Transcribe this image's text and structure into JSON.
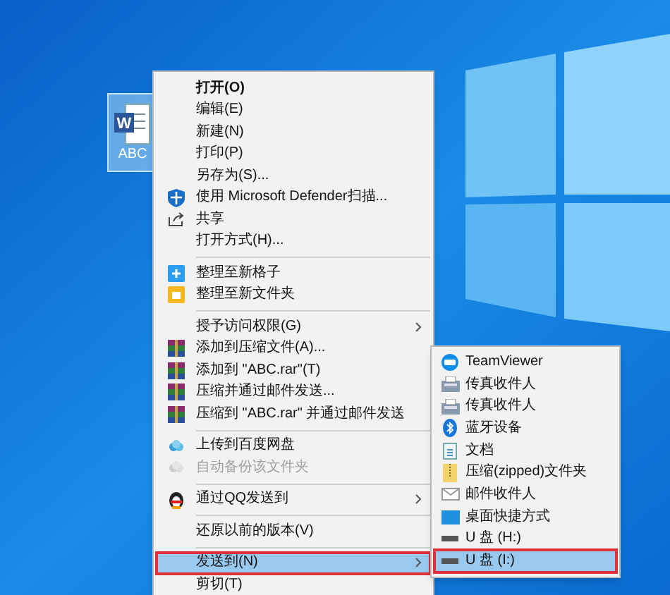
{
  "desktop_icon": {
    "app_letter": "W",
    "label": "ABC"
  },
  "context_menu": {
    "items": [
      {
        "kind": "item",
        "label": "打开(O)",
        "default": true,
        "disabled": false,
        "selected": false,
        "has_submenu": false
      },
      {
        "kind": "item",
        "label": "编辑(E)",
        "default": false,
        "disabled": false,
        "selected": false,
        "has_submenu": false
      },
      {
        "kind": "item",
        "label": "新建(N)",
        "default": false,
        "disabled": false,
        "selected": false,
        "has_submenu": false
      },
      {
        "kind": "item",
        "label": "打印(P)",
        "default": false,
        "disabled": false,
        "selected": false,
        "has_submenu": false
      },
      {
        "kind": "item",
        "label": "另存为(S)...",
        "default": false,
        "disabled": false,
        "selected": false,
        "has_submenu": false
      },
      {
        "kind": "item",
        "label": "使用 Microsoft Defender扫描...",
        "default": false,
        "disabled": false,
        "selected": false,
        "has_submenu": false
      },
      {
        "kind": "item",
        "label": "共享",
        "default": false,
        "disabled": false,
        "selected": false,
        "has_submenu": false
      },
      {
        "kind": "item",
        "label": "打开方式(H)...",
        "default": false,
        "disabled": false,
        "selected": false,
        "has_submenu": false
      },
      {
        "kind": "separator"
      },
      {
        "kind": "item",
        "label": "整理至新格子",
        "default": false,
        "disabled": false,
        "selected": false,
        "has_submenu": false
      },
      {
        "kind": "item",
        "label": "整理至新文件夹",
        "default": false,
        "disabled": false,
        "selected": false,
        "has_submenu": false
      },
      {
        "kind": "separator"
      },
      {
        "kind": "item",
        "label": "授予访问权限(G)",
        "default": false,
        "disabled": false,
        "selected": false,
        "has_submenu": true
      },
      {
        "kind": "item",
        "label": "添加到压缩文件(A)...",
        "default": false,
        "disabled": false,
        "selected": false,
        "has_submenu": false
      },
      {
        "kind": "item",
        "label": "添加到 \"ABC.rar\"(T)",
        "default": false,
        "disabled": false,
        "selected": false,
        "has_submenu": false
      },
      {
        "kind": "item",
        "label": "压缩并通过邮件发送...",
        "default": false,
        "disabled": false,
        "selected": false,
        "has_submenu": false
      },
      {
        "kind": "item",
        "label": "压缩到 \"ABC.rar\" 并通过邮件发送",
        "default": false,
        "disabled": false,
        "selected": false,
        "has_submenu": false
      },
      {
        "kind": "separator"
      },
      {
        "kind": "item",
        "label": "上传到百度网盘",
        "default": false,
        "disabled": false,
        "selected": false,
        "has_submenu": false
      },
      {
        "kind": "item",
        "label": "自动备份该文件夹",
        "default": false,
        "disabled": true,
        "selected": false,
        "has_submenu": false
      },
      {
        "kind": "separator"
      },
      {
        "kind": "item",
        "label": "通过QQ发送到",
        "default": false,
        "disabled": false,
        "selected": false,
        "has_submenu": true
      },
      {
        "kind": "separator"
      },
      {
        "kind": "item",
        "label": "还原以前的版本(V)",
        "default": false,
        "disabled": false,
        "selected": false,
        "has_submenu": false
      },
      {
        "kind": "separator"
      },
      {
        "kind": "item",
        "label": "发送到(N)",
        "default": false,
        "disabled": false,
        "selected": true,
        "has_submenu": true
      },
      {
        "kind": "item",
        "label": "剪切(T)",
        "default": false,
        "disabled": false,
        "selected": false,
        "has_submenu": false
      }
    ]
  },
  "send_to_menu": {
    "items": [
      {
        "label": "TeamViewer",
        "selected": false
      },
      {
        "label": "传真收件人",
        "selected": false
      },
      {
        "label": "传真收件人",
        "selected": false
      },
      {
        "label": "蓝牙设备",
        "selected": false
      },
      {
        "label": "文档",
        "selected": false
      },
      {
        "label": "压缩(zipped)文件夹",
        "selected": false
      },
      {
        "label": "邮件收件人",
        "selected": false
      },
      {
        "label": "桌面快捷方式",
        "selected": false
      },
      {
        "label": "U 盘 (H:)",
        "selected": false
      },
      {
        "label": "U 盘 (I:)",
        "selected": true
      }
    ]
  }
}
